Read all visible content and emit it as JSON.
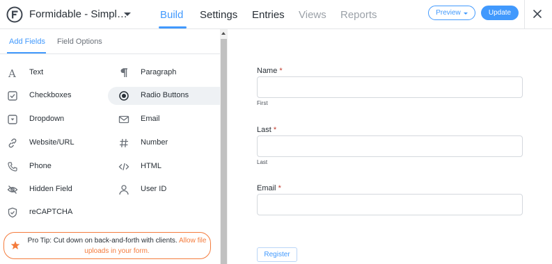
{
  "header": {
    "form_title": "Formidable - Simpl…",
    "tabs": [
      {
        "label": "Build",
        "state": "active"
      },
      {
        "label": "Settings",
        "state": "normal"
      },
      {
        "label": "Entries",
        "state": "normal"
      },
      {
        "label": "Views",
        "state": "muted"
      },
      {
        "label": "Reports",
        "state": "muted"
      }
    ],
    "preview_label": "Preview",
    "update_label": "Update"
  },
  "sidebar": {
    "tabs": [
      {
        "label": "Add Fields",
        "state": "active"
      },
      {
        "label": "Field Options",
        "state": "inactive"
      }
    ],
    "fields": [
      {
        "label": "Text",
        "icon": "text-icon"
      },
      {
        "label": "Paragraph",
        "icon": "paragraph-icon"
      },
      {
        "label": "Checkboxes",
        "icon": "checkbox-icon"
      },
      {
        "label": "Radio Buttons",
        "icon": "radio-button-icon",
        "highlighted": true
      },
      {
        "label": "Dropdown",
        "icon": "dropdown-icon"
      },
      {
        "label": "Email",
        "icon": "envelope-icon"
      },
      {
        "label": "Website/URL",
        "icon": "link-icon"
      },
      {
        "label": "Number",
        "icon": "hash-icon"
      },
      {
        "label": "Phone",
        "icon": "phone-icon"
      },
      {
        "label": "HTML",
        "icon": "code-icon"
      },
      {
        "label": "Hidden Field",
        "icon": "eye-slash-icon"
      },
      {
        "label": "User ID",
        "icon": "user-icon"
      },
      {
        "label": "reCAPTCHA",
        "icon": "shield-check-icon"
      }
    ],
    "pro_tip": {
      "prefix": "Pro Tip: Cut down on back-and-forth with clients. ",
      "link": "Allow file uploads in your form."
    }
  },
  "form": {
    "fields": [
      {
        "label": "Name",
        "required_mark": "*",
        "sublabel": "First"
      },
      {
        "label": "Last",
        "required_mark": "*",
        "sublabel": "Last"
      },
      {
        "label": "Email",
        "required_mark": "*",
        "sublabel": ""
      }
    ],
    "submit_label": "Register"
  },
  "colors": {
    "accent": "#4199fd",
    "pro_tip_orange": "#f47b3c",
    "required_red": "#c0392b",
    "highlight_bg": "#eef1f4"
  }
}
